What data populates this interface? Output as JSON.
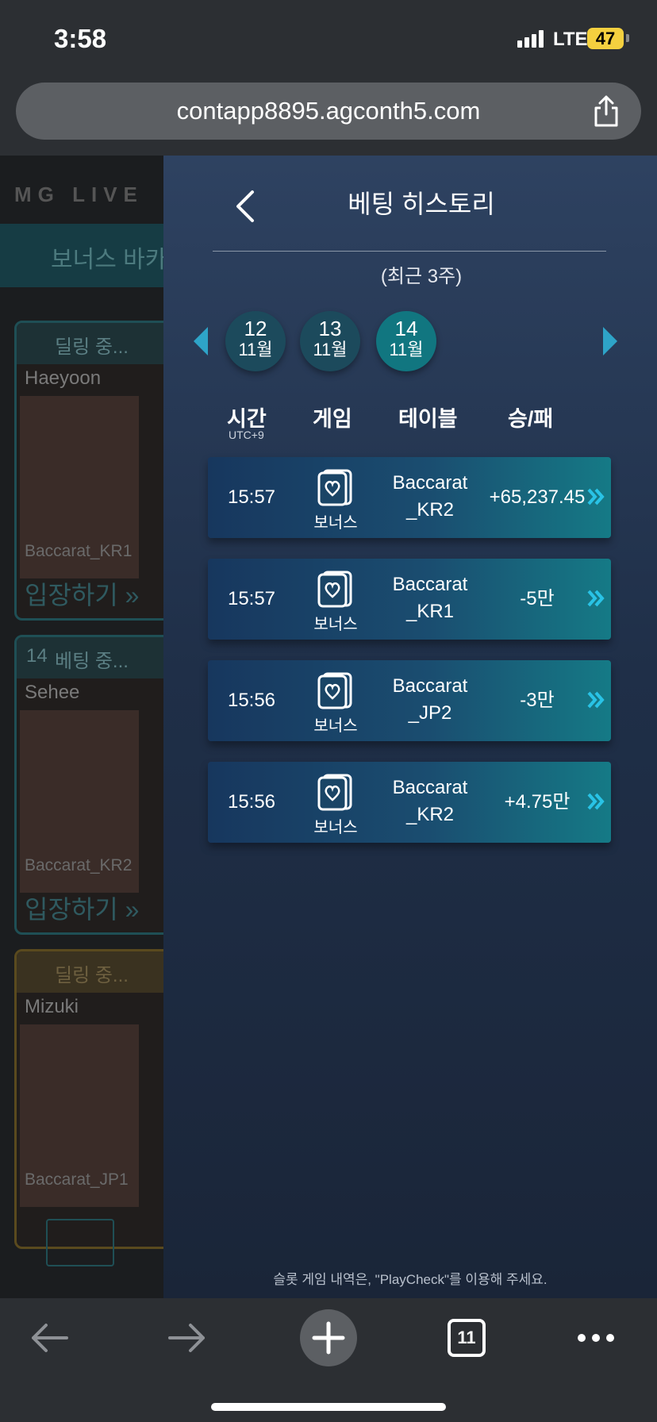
{
  "status_bar": {
    "time": "3:58",
    "network": "LTE",
    "battery": "47"
  },
  "browser": {
    "url": "contapp8895.agconth5.com",
    "tab_count": "11"
  },
  "lobby": {
    "logo": "MG LIVE",
    "bonus_label": "보너스 바카",
    "cards": [
      {
        "badge": "",
        "status": "딜링 중...",
        "dealer": "Haeyoon",
        "table": "Baccarat_KR1",
        "enter": "입장하기 »"
      },
      {
        "badge": "14",
        "status": "베팅 중...",
        "dealer": "Sehee",
        "table": "Baccarat_KR2",
        "enter": "입장하기 »"
      },
      {
        "badge": "",
        "status": "딜링 중...",
        "dealer": "Mizuki",
        "table": "Baccarat_JP1",
        "enter": ""
      }
    ]
  },
  "panel": {
    "title": "베팅 히스토리",
    "subtitle": "(최근 3주)",
    "dates": [
      {
        "day": "12",
        "month": "11월",
        "active": false
      },
      {
        "day": "13",
        "month": "11월",
        "active": false
      },
      {
        "day": "14",
        "month": "11월",
        "active": true
      }
    ],
    "columns": {
      "time": "시간",
      "time_sub": "UTC+9",
      "game": "게임",
      "table": "테이블",
      "result": "승/패"
    },
    "rows": [
      {
        "time": "15:57",
        "game": "보너스",
        "table_line1": "Baccarat",
        "table_line2": "_KR2",
        "result": "+65,237.45"
      },
      {
        "time": "15:57",
        "game": "보너스",
        "table_line1": "Baccarat",
        "table_line2": "_KR1",
        "result": "-5만"
      },
      {
        "time": "15:56",
        "game": "보너스",
        "table_line1": "Baccarat",
        "table_line2": "_JP2",
        "result": "-3만"
      },
      {
        "time": "15:56",
        "game": "보너스",
        "table_line1": "Baccarat",
        "table_line2": "_KR2",
        "result": "+4.75만"
      }
    ],
    "footer_note": "슬롯 게임 내역은, \"PlayCheck\"를 이용해 주세요."
  },
  "colors": {
    "accent": "#2ea4c8",
    "active_date": "#117680",
    "panel_bg": "#2e4261"
  }
}
